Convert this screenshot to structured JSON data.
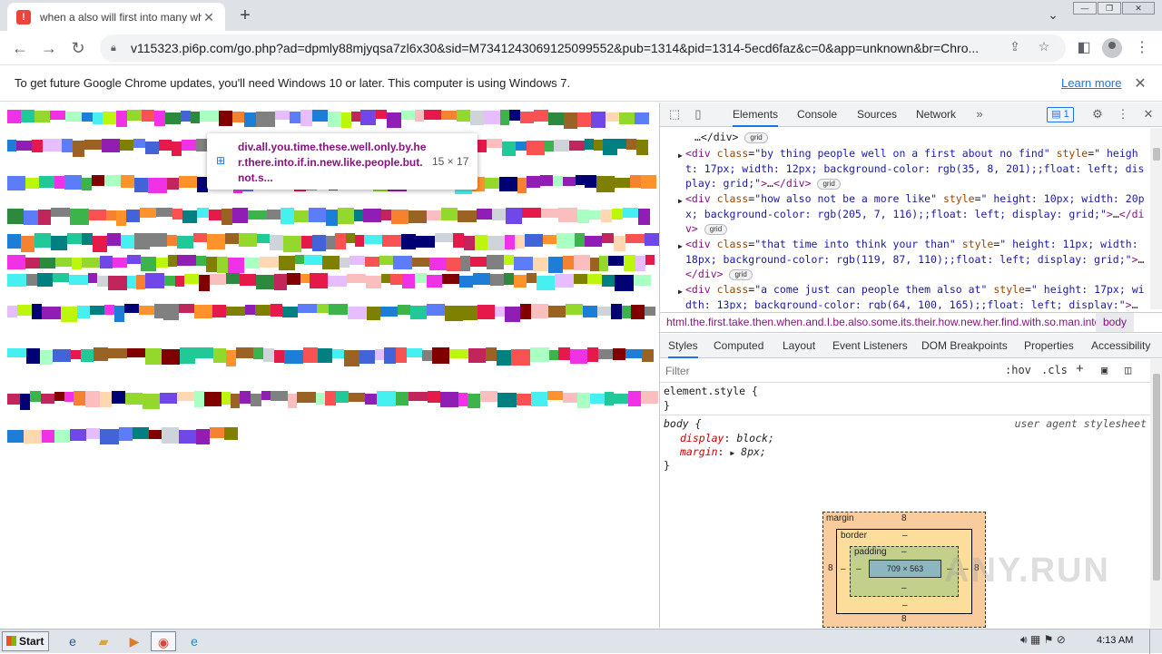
{
  "browser": {
    "tab_title": "when a also will first into many what",
    "favicon_glyph": "!",
    "url": "v115323.pi6p.com/go.php?ad=dpmly88mjyqsa7zl6x30&sid=M7341243069125099552&pub=1314&pid=1314-5ecd6faz&c=0&app=unknown&br=Chro...",
    "window_buttons": [
      "—",
      "❐",
      "✕"
    ]
  },
  "infobar": {
    "message": "To get future Google Chrome updates, you'll need Windows 10 or later. This computer is using Windows 7.",
    "link": "Learn more"
  },
  "page": {
    "tooltip_text": "div.all.you.time.these.well.only.by.her.there.into.if.in.new.like.people.but.not.s...",
    "tooltip_size": "15 × 17"
  },
  "devtools": {
    "tabs": [
      "Elements",
      "Console",
      "Sources",
      "Network"
    ],
    "issues_count": "1",
    "dom_lines": [
      {
        "type": "close",
        "text": "…</div>",
        "badge": "grid"
      },
      {
        "type": "div",
        "cls": "by thing people well on a first about no find",
        "style": "  height: 17px; width: 12px; background-color: rgb(35, 8, 201);;float: left; display: grid;",
        "badge": "grid"
      },
      {
        "type": "div",
        "cls": "how also not be a more like",
        "style": "  height: 10px; width: 20px; background-color: rgb(205, 7, 116);;float: left; display: grid;",
        "badge": "grid"
      },
      {
        "type": "div",
        "cls": "that time into think your than",
        "style": "  height: 11px; width: 18px; background-color: rgb(119, 87, 110);;float: left; display: grid;",
        "badge": "grid"
      },
      {
        "type": "div",
        "cls": "a come just can people them also at",
        "style": "  height: 17px; width: 13px; background-color: rgb(64, 100, 165);;float: left; display:",
        "badge": ""
      }
    ],
    "breadcrumb_path": "html.the.first.take.then.when.and.I.be.also.some.its.their.how.new.her.find.with.so.man.into",
    "breadcrumb_current": "body",
    "styles_tabs": [
      "Styles",
      "Computed",
      "Layout",
      "Event Listeners",
      "DOM Breakpoints",
      "Properties",
      "Accessibility"
    ],
    "filter_placeholder": "Filter",
    "hov": ":hov",
    "cls": ".cls",
    "element_style": "element.style {",
    "close_brace": "}",
    "body_selector": "body {",
    "ua_label": "user agent stylesheet",
    "display_prop": "display",
    "display_val": "block;",
    "margin_prop": "margin",
    "margin_val": "8px;",
    "boxmodel": {
      "margin_label": "margin",
      "margin_value": "8",
      "border_label": "border",
      "border_value": "–",
      "padding_label": "padding",
      "padding_value": "–",
      "content_size": "709 × 563",
      "dash": "–"
    }
  },
  "watermark": "ANY.RUN",
  "taskbar": {
    "start_label": "Start",
    "clock": "4:13 AM"
  },
  "colors": {
    "accent": "#1a73e8",
    "tag": "#881280",
    "attr": "#994500",
    "value": "#1a1aa6"
  }
}
